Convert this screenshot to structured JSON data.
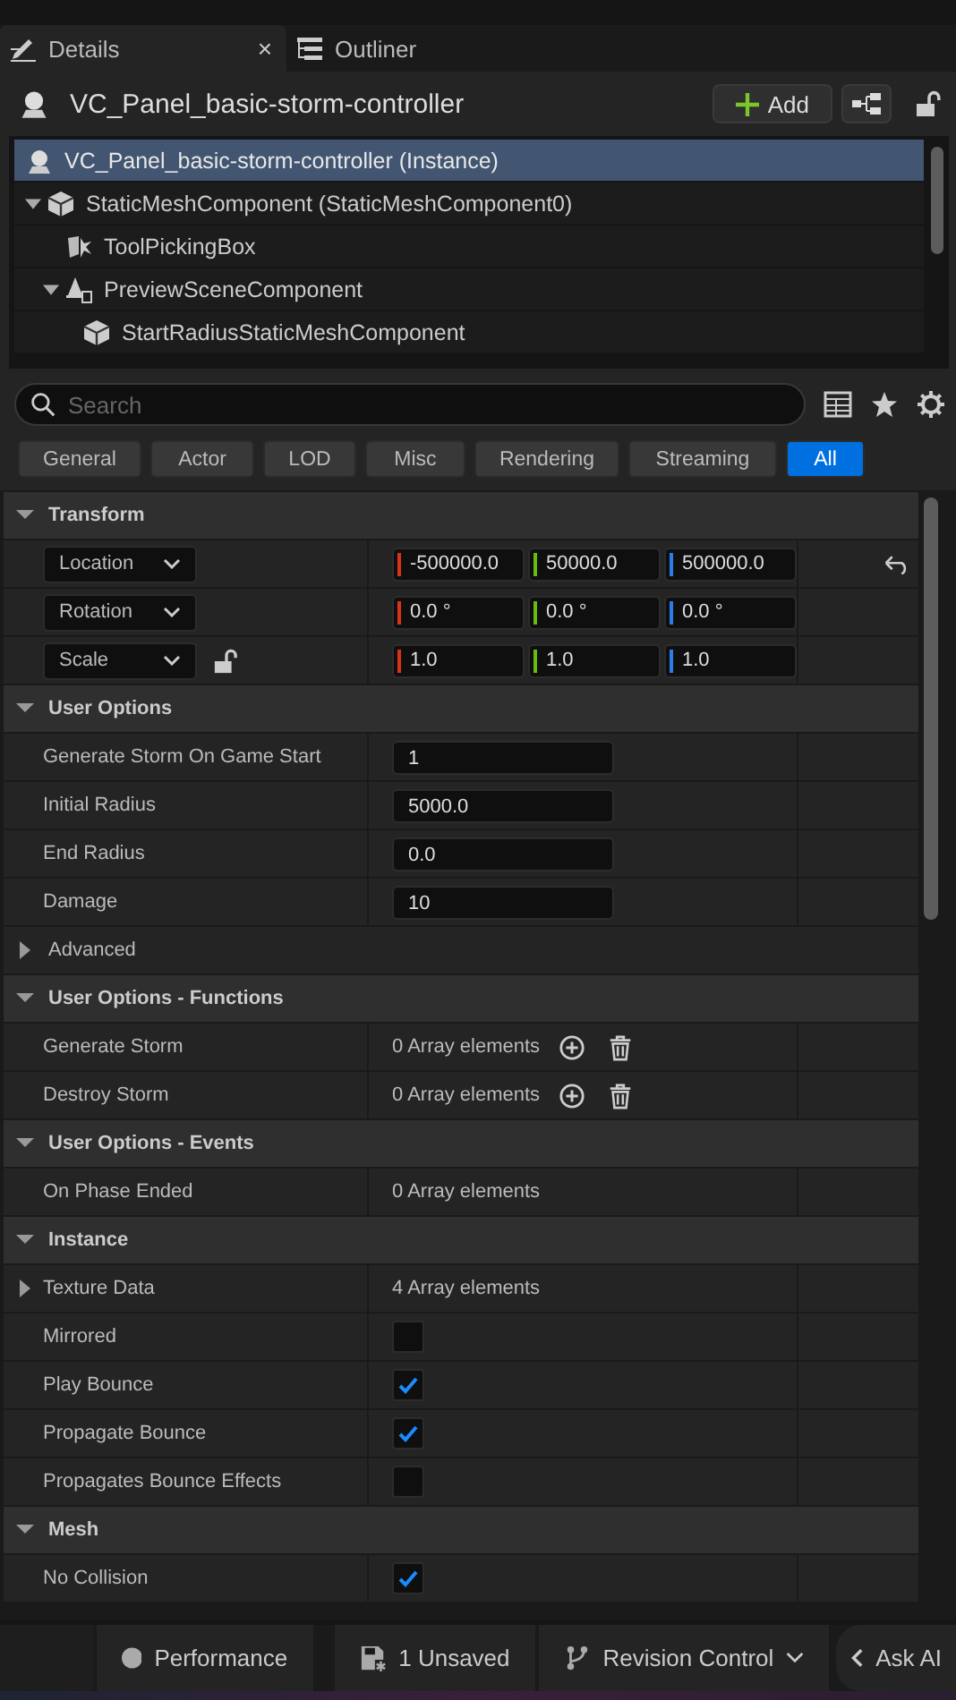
{
  "tabs": [
    {
      "label": "Details",
      "selected": true,
      "close": "×"
    },
    {
      "label": "Outliner",
      "selected": false
    }
  ],
  "header": {
    "title": "VC_Panel_basic-storm-controller",
    "add_button": "Add"
  },
  "tree": [
    {
      "label": "VC_Panel_basic-storm-controller (Instance)",
      "kind": "actor",
      "selected": true
    },
    {
      "label": "StaticMeshComponent (StaticMeshComponent0)",
      "kind": "mesh",
      "selected": false,
      "expanded": true,
      "children": [
        {
          "label": "ToolPickingBox",
          "kind": "tool",
          "selected": false
        },
        {
          "label": "PreviewSceneComponent",
          "kind": "scene",
          "selected": false,
          "expanded": true,
          "children": [
            {
              "label": "StartRadiusStaticMeshComponent",
              "kind": "mesh",
              "selected": false
            }
          ]
        }
      ]
    }
  ],
  "search": {
    "placeholder": "Search"
  },
  "filters": [
    {
      "label": "General",
      "selected": false
    },
    {
      "label": "Actor",
      "selected": false
    },
    {
      "label": "LOD",
      "selected": false
    },
    {
      "label": "Misc",
      "selected": false
    },
    {
      "label": "Rendering",
      "selected": false
    },
    {
      "label": "Streaming",
      "selected": false
    },
    {
      "label": "All",
      "selected": true
    }
  ],
  "sections": [
    {
      "title": "Transform",
      "expanded": true,
      "rows": [
        {
          "kind": "vector",
          "label": "Location",
          "values": [
            "-500000.0",
            "50000.0",
            "500000.0"
          ],
          "resettable": true
        },
        {
          "kind": "vector",
          "label": "Rotation",
          "values": [
            "0.0 °",
            "0.0 °",
            "0.0 °"
          ]
        },
        {
          "kind": "vector",
          "label": "Scale",
          "values": [
            "1.0",
            "1.0",
            "1.0"
          ],
          "lock_icon": true
        }
      ]
    },
    {
      "title": "User Options",
      "expanded": true,
      "rows": [
        {
          "kind": "number",
          "label": "Generate Storm On Game Start",
          "value": "1"
        },
        {
          "kind": "number",
          "label": "Initial Radius",
          "value": "5000.0"
        },
        {
          "kind": "number",
          "label": "End Radius",
          "value": "0.0"
        },
        {
          "kind": "number",
          "label": "Damage",
          "value": "10"
        },
        {
          "kind": "group",
          "label": "Advanced",
          "expanded": false
        }
      ]
    },
    {
      "title": "User Options - Functions",
      "expanded": true,
      "rows": [
        {
          "kind": "array",
          "label": "Generate Storm",
          "value": "0 Array elements",
          "editable": true
        },
        {
          "kind": "array",
          "label": "Destroy Storm",
          "value": "0 Array elements",
          "editable": true
        }
      ]
    },
    {
      "title": "User Options - Events",
      "expanded": true,
      "rows": [
        {
          "kind": "array",
          "label": "On Phase Ended",
          "value": "0 Array elements"
        }
      ]
    },
    {
      "title": "Instance",
      "expanded": true,
      "rows": [
        {
          "kind": "array",
          "label": "Texture Data",
          "value": "4 Array elements",
          "expandable": true
        },
        {
          "kind": "checkbox",
          "label": "Mirrored",
          "checked": false
        },
        {
          "kind": "checkbox",
          "label": "Play Bounce",
          "checked": true
        },
        {
          "kind": "checkbox",
          "label": "Propagate Bounce",
          "checked": true
        },
        {
          "kind": "checkbox",
          "label": "Propagates Bounce Effects",
          "checked": false
        }
      ]
    },
    {
      "title": "Mesh",
      "expanded": true,
      "rows": [
        {
          "kind": "checkbox",
          "label": "No Collision",
          "checked": true
        }
      ]
    }
  ],
  "status_bar": [
    {
      "kind": "performance",
      "label": "Performance"
    },
    {
      "kind": "unsaved",
      "label": "1 Unsaved"
    },
    {
      "kind": "revision",
      "label": "Revision Control"
    },
    {
      "kind": "ai",
      "label": "Ask AI"
    }
  ]
}
